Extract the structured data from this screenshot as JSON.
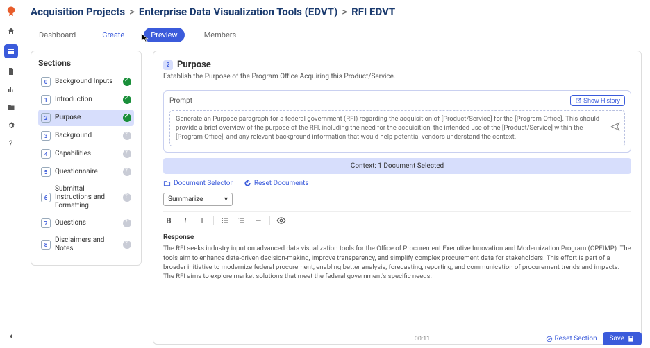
{
  "breadcrumb": {
    "root": "Acquisition Projects",
    "mid": "Enterprise Data Visualization Tools (EDVT)",
    "leaf": "RFI EDVT"
  },
  "tabs": [
    {
      "label": "Dashboard"
    },
    {
      "label": "Create"
    },
    {
      "label": "Preview"
    },
    {
      "label": "Members"
    }
  ],
  "sections_title": "Sections",
  "sections": [
    {
      "num": "0",
      "label": "Background Inputs",
      "status": "done"
    },
    {
      "num": "1",
      "label": "Introduction",
      "status": "done"
    },
    {
      "num": "2",
      "label": "Purpose",
      "status": "done",
      "active": true
    },
    {
      "num": "3",
      "label": "Background",
      "status": "pending"
    },
    {
      "num": "4",
      "label": "Capabilities",
      "status": "pending"
    },
    {
      "num": "5",
      "label": "Questionnaire",
      "status": "pending"
    },
    {
      "num": "6",
      "label": "Submittal Instructions and Formatting",
      "status": "pending"
    },
    {
      "num": "7",
      "label": "Questions",
      "status": "pending"
    },
    {
      "num": "8",
      "label": "Disclaimers and Notes",
      "status": "pending"
    }
  ],
  "content": {
    "num": "2",
    "title": "Purpose",
    "subtitle": "Establish the Purpose of the Program Office Acquiring this Product/Service.",
    "prompt_label": "Prompt",
    "show_history": "Show History",
    "prompt_text": "Generate an Purpose paragraph for a federal government (RFI) regarding the acquisition of [Product/Service] for the [Program Office]. This should provide a brief overview of the purpose of the RFI, including the need for the acquisition, the intended use of the [Product/Service] within the [Program Office], and any relevant background information that would help potential vendors understand the context.",
    "context_bar": "Context: 1 Document Selected",
    "doc_selector": "Document Selector",
    "reset_docs": "Reset Documents",
    "summarize": "Summarize",
    "response_label": "Response",
    "response_body": "The RFI seeks industry input on advanced data visualization tools for the Office of Procurement Executive Innovation and Modernization Program (OPEIMP). The tools aim to enhance data-driven decision-making, improve transparency, and simplify complex procurement data for stakeholders. This effort is part of a broader initiative to modernize federal procurement, enabling better analysis, forecasting, reporting, and communication of procurement trends and impacts. The RFI aims to explore market solutions that meet the federal government's specific needs.",
    "counter": "00:11",
    "reset_section": "Reset Section",
    "save": "Save"
  }
}
